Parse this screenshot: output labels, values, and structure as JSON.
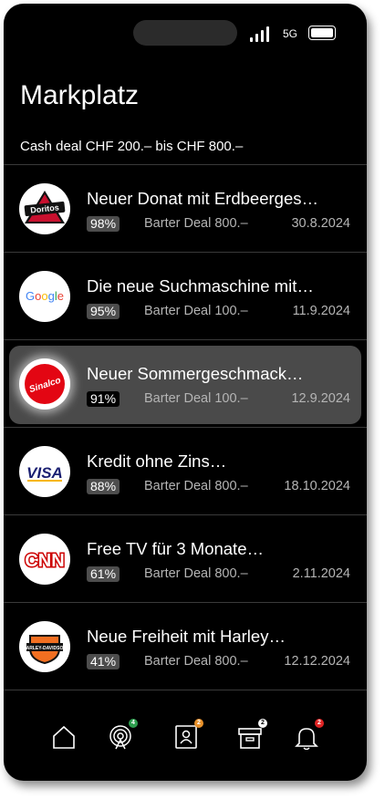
{
  "status": {
    "network": "5G"
  },
  "header": {
    "title": "Markplatz",
    "subtitle": "Cash deal CHF 200.– bis CHF 800.–"
  },
  "items": [
    {
      "logo": "doritos-logo",
      "logo_text": "Doritos",
      "title": "Neuer Donat mit Erdbeerges…",
      "percent": "98%",
      "deal": "Barter Deal 800.–",
      "date": "30.8.2024"
    },
    {
      "logo": "google-logo",
      "logo_text": "Google",
      "title": "Die neue Suchmaschine mit…",
      "percent": "95%",
      "deal": "Barter Deal 100.–",
      "date": "11.9.2024"
    },
    {
      "logo": "sinalco-logo",
      "logo_text": "Sinalco",
      "title": "Neuer Sommergeschmack…",
      "percent": "91%",
      "deal": "Barter Deal 100.–",
      "date": "12.9.2024",
      "selected": true
    },
    {
      "logo": "visa-logo",
      "logo_text": "VISA",
      "title": "Kredit ohne Zins…",
      "percent": "88%",
      "deal": "Barter Deal 800.–",
      "date": "18.10.2024"
    },
    {
      "logo": "cnn-logo",
      "logo_text": "CNN",
      "title": "Free TV für 3 Monate…",
      "percent": "61%",
      "deal": "Barter Deal 800.–",
      "date": "2.11.2024"
    },
    {
      "logo": "harley-davidson-logo",
      "logo_text": "HARLEY-DAVIDSON",
      "title": "Neue Freiheit mit Harley…",
      "percent": "41%",
      "deal": "Barter Deal 800.–",
      "date": "12.12.2024"
    }
  ],
  "nav": [
    {
      "icon": "home-icon"
    },
    {
      "icon": "broadcast-icon",
      "badge": "4",
      "badge_color": "#2e9e4f"
    },
    {
      "icon": "contact-card-icon",
      "badge": "2",
      "badge_color": "#e8912a"
    },
    {
      "icon": "archive-box-icon",
      "badge": "2",
      "badge_color": "#ffffff"
    },
    {
      "icon": "bell-icon",
      "badge": "2",
      "badge_color": "#e02424"
    }
  ]
}
